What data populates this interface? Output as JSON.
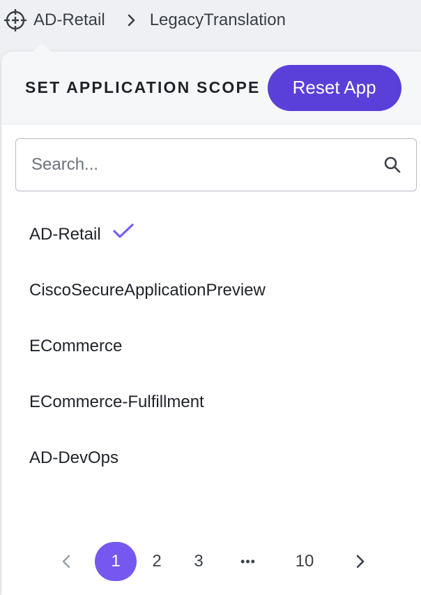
{
  "breadcrumb": {
    "root": "AD-Retail",
    "current": "LegacyTranslation"
  },
  "panel": {
    "title": "SET APPLICATION SCOPE",
    "reset_label": "Reset App"
  },
  "search": {
    "placeholder": "Search...",
    "value": ""
  },
  "applications": [
    {
      "name": "AD-Retail",
      "selected": true
    },
    {
      "name": "CiscoSecureApplicationPreview",
      "selected": false
    },
    {
      "name": "ECommerce",
      "selected": false
    },
    {
      "name": "ECommerce-Fulfillment",
      "selected": false
    },
    {
      "name": "AD-DevOps",
      "selected": false
    }
  ],
  "pagination": {
    "current": "1",
    "pages": [
      "1",
      "2",
      "3"
    ],
    "ellipsis": "•••",
    "last": "10"
  },
  "icons": {
    "scope": "crosshair-icon",
    "separator": "chevron-right-icon",
    "search": "search-icon",
    "selected": "check-icon",
    "prev": "chevron-left-icon",
    "next": "chevron-right-icon"
  },
  "colors": {
    "accent": "#5b3fd9",
    "page_active": "#7658f0",
    "check": "#7a5cf0"
  }
}
